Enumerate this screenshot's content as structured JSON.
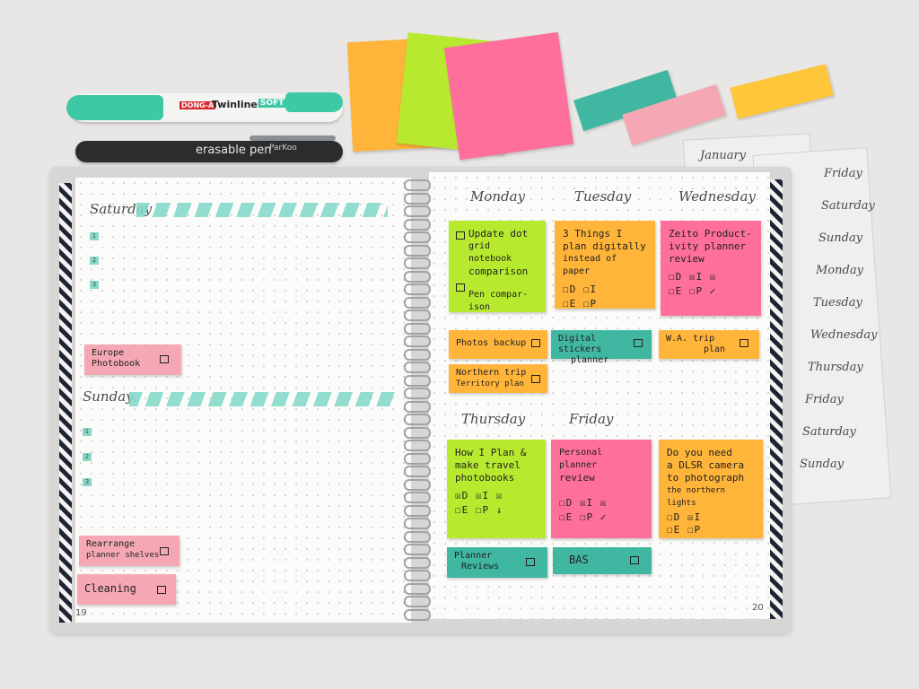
{
  "pens": {
    "mint_brand": "DONG-A",
    "mint_model": "Twinliner",
    "mint_tag": "SOFT",
    "black_label": "erasable pen",
    "black_brand": "ParKoo"
  },
  "colors": {
    "green": "#b7ea2f",
    "orange": "#ffb43a",
    "pink": "#ff6f9c",
    "teal": "#3fb7a1",
    "light_pink": "#f5a8b4",
    "yellow": "#ffc63a",
    "mint": "#3ec9a5"
  },
  "left_page": {
    "saturday_header": "Saturday",
    "sunday_header": "Sunday",
    "bullets": [
      "1",
      "2",
      "3"
    ],
    "tab_europe": [
      "Europe",
      "Photobook"
    ],
    "tab_rearrange": [
      "Rearrange",
      "planner shelves"
    ],
    "tab_cleaning": "Cleaning",
    "page_number": "19"
  },
  "right_page": {
    "days": {
      "monday": "Monday",
      "tuesday": "Tuesday",
      "wednesday": "Wednesday",
      "thursday": "Thursday",
      "friday": "Friday"
    },
    "notes": {
      "monday": {
        "task1": [
          "Update dot",
          "grid notebook",
          "comparison"
        ],
        "task2": [
          "Pen compar-",
          "ison"
        ]
      },
      "tuesday": {
        "lines": [
          "3 Things I",
          "plan digitally",
          "instead of paper"
        ],
        "row1": "☐D ☐I",
        "row2": "☐E ☐P"
      },
      "wednesday": {
        "lines": [
          "Zeito Product-",
          "ivity planner",
          "review"
        ],
        "row1": "☐D ☒I ☒",
        "row2": "☐E ☐P ✓"
      },
      "thursday": {
        "lines": [
          "How I Plan &",
          "make travel",
          "photobooks"
        ],
        "row1": "☒D ☒I ☒",
        "row2": "☐E ☐P ↓"
      },
      "friday": {
        "lines": [
          "Personal planner",
          "review"
        ],
        "row1": "☐D ☒I ☒",
        "row2": "☐E ☐P ✓"
      },
      "friday2": {
        "lines": [
          "Do you need",
          "a DLSR camera",
          "to photograph",
          "the northern lights"
        ],
        "row1": "☐D ☒I",
        "row2": "☐E ☐P"
      }
    },
    "tabs": {
      "photos_backup": "Photos backup",
      "digital_stickers": [
        "Digital stickers",
        "planner"
      ],
      "wa_trip": [
        "W.A. trip",
        "plan"
      ],
      "northern_trip": [
        "Northern trip",
        "Territory plan"
      ],
      "planner_reviews": [
        "Planner",
        "Reviews"
      ],
      "bas": "BAS"
    },
    "page_number": "20"
  },
  "sticker_sheet": {
    "january": "January",
    "words": [
      "Friday",
      "Saturday",
      "Sunday",
      "Monday",
      "Tuesday",
      "Wednesday",
      "Thursday",
      "Friday",
      "Saturday",
      "Sunday"
    ]
  }
}
